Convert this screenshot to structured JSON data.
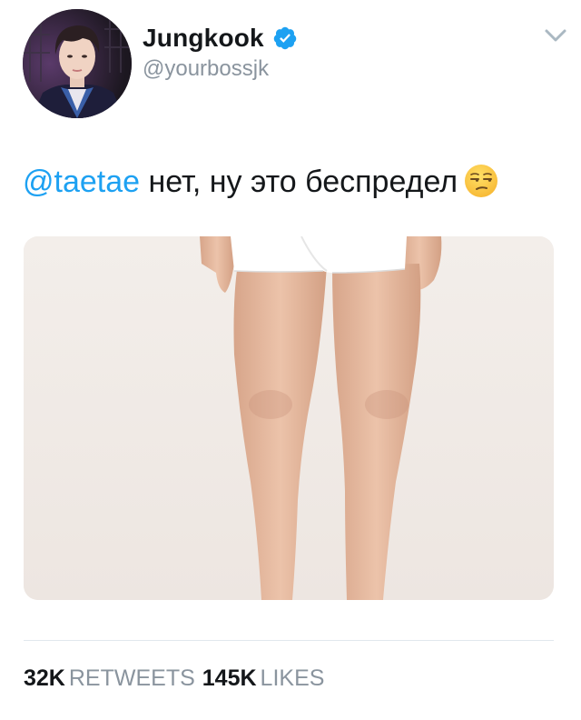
{
  "user": {
    "display_name": "Jungkook",
    "handle": "@yourbossjk",
    "verified": true,
    "avatar_icon": "profile-photo"
  },
  "tweet": {
    "mention": "@taetae",
    "text": " нет, ну это беспредел",
    "emoji": "unamused-face-emoji"
  },
  "media": {
    "icon": "photo-legs-white-briefs"
  },
  "stats": {
    "retweets_count": "32K",
    "retweets_label": "RETWEETS",
    "likes_count": "145K",
    "likes_label": "LIKES"
  },
  "colors": {
    "accent": "#1da1f2",
    "secondary_text": "#8a949e",
    "divider": "#e1e8ed"
  }
}
